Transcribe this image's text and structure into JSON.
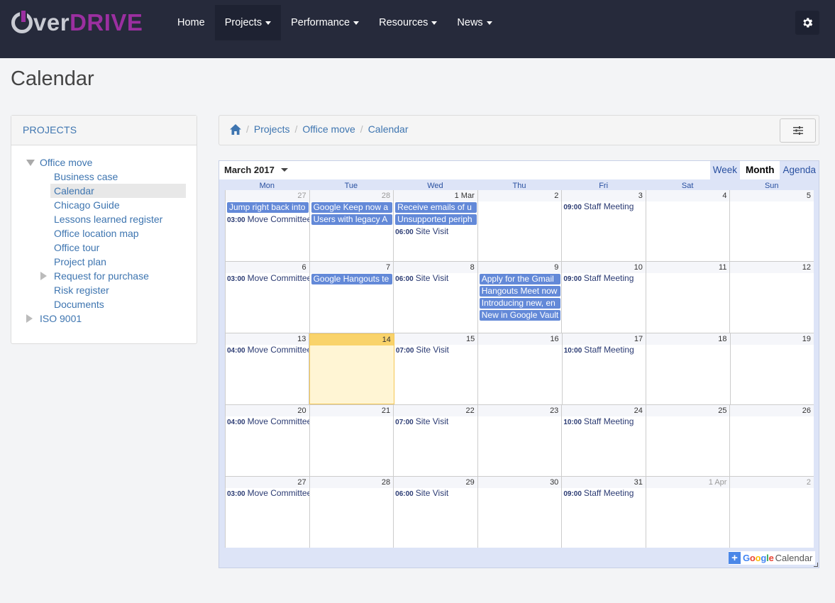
{
  "brand": {
    "prefix": "ver",
    "suffix": "DRIVE",
    "accent": "#9b2fa0"
  },
  "nav": {
    "items": [
      {
        "label": "Home",
        "caret": false,
        "active": false
      },
      {
        "label": "Projects",
        "caret": true,
        "active": true
      },
      {
        "label": "Performance",
        "caret": true,
        "active": false
      },
      {
        "label": "Resources",
        "caret": true,
        "active": false
      },
      {
        "label": "News",
        "caret": true,
        "active": false
      }
    ],
    "settings_icon": "gear-icon"
  },
  "page": {
    "title": "Calendar"
  },
  "sidebar": {
    "heading": "PROJECTS",
    "tree": {
      "root": "Office move",
      "children": [
        "Business case",
        "Calendar",
        "Chicago Guide",
        "Lessons learned register",
        "Office location map",
        "Office tour",
        "Project plan",
        "Request for purchase",
        "Risk register",
        "Documents"
      ],
      "selected": "Calendar",
      "other_root": "ISO 9001"
    }
  },
  "breadcrumb": {
    "items": [
      "Projects",
      "Office move",
      "Calendar"
    ],
    "home_icon": "home-icon"
  },
  "calendar": {
    "month_label": "March 2017",
    "views": [
      "Week",
      "Month",
      "Agenda"
    ],
    "active_view": "Month",
    "weekdays": [
      "Mon",
      "Tue",
      "Wed",
      "Thu",
      "Fri",
      "Sat",
      "Sun"
    ],
    "weeks": [
      [
        {
          "label": "27",
          "other": true,
          "events": [
            {
              "kind": "chip",
              "title": "Jump right back into"
            },
            {
              "kind": "timed",
              "time": "03:00",
              "title": "Move Committee"
            }
          ]
        },
        {
          "label": "28",
          "other": true,
          "events": [
            {
              "kind": "chip",
              "title": "Google Keep now a"
            },
            {
              "kind": "chip",
              "title": "Users with legacy A"
            }
          ]
        },
        {
          "label": "1 Mar",
          "events": [
            {
              "kind": "chip",
              "title": "Receive emails of u"
            },
            {
              "kind": "chip",
              "title": "Unsupported periph"
            },
            {
              "kind": "timed",
              "time": "06:00",
              "title": "Site Visit"
            }
          ]
        },
        {
          "label": "2",
          "events": []
        },
        {
          "label": "3",
          "events": [
            {
              "kind": "timed",
              "time": "09:00",
              "title": "Staff Meeting"
            }
          ]
        },
        {
          "label": "4",
          "events": []
        },
        {
          "label": "5",
          "events": []
        }
      ],
      [
        {
          "label": "6",
          "events": [
            {
              "kind": "timed",
              "time": "03:00",
              "title": "Move Committee"
            }
          ]
        },
        {
          "label": "7",
          "events": [
            {
              "kind": "chip",
              "title": "Google Hangouts te"
            }
          ]
        },
        {
          "label": "8",
          "events": [
            {
              "kind": "timed",
              "time": "06:00",
              "title": "Site Visit"
            }
          ]
        },
        {
          "label": "9",
          "events": [
            {
              "kind": "chip",
              "title": "Apply for the Gmail"
            },
            {
              "kind": "chip",
              "title": "Hangouts Meet now"
            },
            {
              "kind": "chip",
              "title": "Introducing new, en"
            },
            {
              "kind": "chip",
              "title": "New in Google Vault"
            }
          ]
        },
        {
          "label": "10",
          "events": [
            {
              "kind": "timed",
              "time": "09:00",
              "title": "Staff Meeting"
            }
          ]
        },
        {
          "label": "11",
          "events": []
        },
        {
          "label": "12",
          "events": []
        }
      ],
      [
        {
          "label": "13",
          "events": [
            {
              "kind": "timed",
              "time": "04:00",
              "title": "Move Committee"
            }
          ]
        },
        {
          "label": "14",
          "today": true,
          "events": []
        },
        {
          "label": "15",
          "events": [
            {
              "kind": "timed",
              "time": "07:00",
              "title": "Site Visit"
            }
          ]
        },
        {
          "label": "16",
          "events": []
        },
        {
          "label": "17",
          "events": [
            {
              "kind": "timed",
              "time": "10:00",
              "title": "Staff Meeting"
            }
          ]
        },
        {
          "label": "18",
          "events": []
        },
        {
          "label": "19",
          "events": []
        }
      ],
      [
        {
          "label": "20",
          "events": [
            {
              "kind": "timed",
              "time": "04:00",
              "title": "Move Committee"
            }
          ]
        },
        {
          "label": "21",
          "events": []
        },
        {
          "label": "22",
          "events": [
            {
              "kind": "timed",
              "time": "07:00",
              "title": "Site Visit"
            }
          ]
        },
        {
          "label": "23",
          "events": []
        },
        {
          "label": "24",
          "events": [
            {
              "kind": "timed",
              "time": "10:00",
              "title": "Staff Meeting"
            }
          ]
        },
        {
          "label": "25",
          "events": []
        },
        {
          "label": "26",
          "events": []
        }
      ],
      [
        {
          "label": "27",
          "events": [
            {
              "kind": "timed",
              "time": "03:00",
              "title": "Move Committee"
            }
          ]
        },
        {
          "label": "28",
          "events": []
        },
        {
          "label": "29",
          "events": [
            {
              "kind": "timed",
              "time": "06:00",
              "title": "Site Visit"
            }
          ]
        },
        {
          "label": "30",
          "events": []
        },
        {
          "label": "31",
          "events": [
            {
              "kind": "timed",
              "time": "09:00",
              "title": "Staff Meeting"
            }
          ]
        },
        {
          "label": "1 Apr",
          "other": true,
          "events": []
        },
        {
          "label": "2",
          "other": true,
          "events": []
        }
      ]
    ],
    "footer": {
      "google": "Google",
      "calendar": "Calendar"
    }
  }
}
